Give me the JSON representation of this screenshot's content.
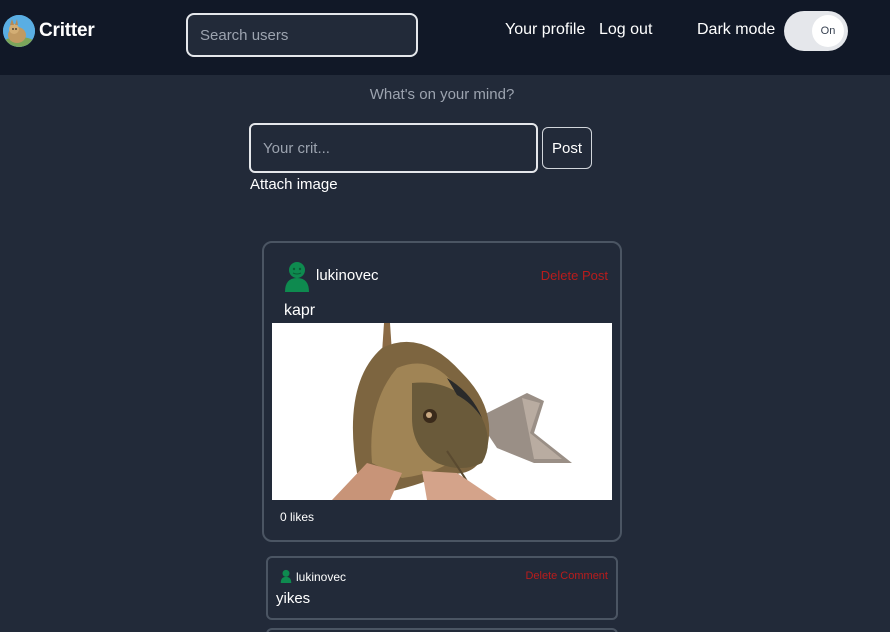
{
  "app": {
    "brand_name": "Critter",
    "logo_icon": "critter-logo-icon"
  },
  "navbar": {
    "search_placeholder": "Search users",
    "profile_link": "Your profile",
    "logout_link": "Log out",
    "dark_mode_label": "Dark mode",
    "dark_mode_toggle": "On"
  },
  "composer": {
    "prompt": "What's on your mind?",
    "input_placeholder": "Your crit...",
    "post_button": "Post",
    "attach_image": "Attach image"
  },
  "post": {
    "username": "lukinovec",
    "avatar_icon": "user-avatar-icon",
    "delete_label": "Delete Post",
    "text": "kapr",
    "image": "carp-fish-photo",
    "likes": "0 likes"
  },
  "comment": {
    "username": "lukinovec",
    "delete_label": "Delete Comment",
    "text": "yikes"
  },
  "colors": {
    "background": "#222a39",
    "navbar": "#111827",
    "border": "#4b5563",
    "delete": "#b91c1c",
    "avatar": "#0e8a4f"
  }
}
